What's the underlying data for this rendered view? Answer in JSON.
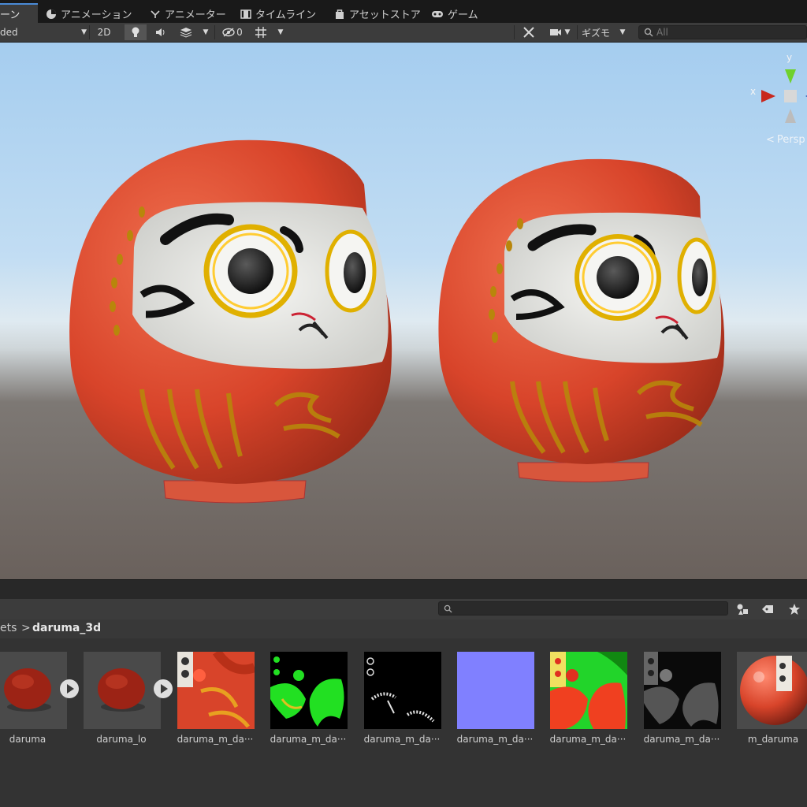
{
  "tabs": [
    {
      "label": "ーン",
      "icon": "scene-icon"
    },
    {
      "label": "アニメーション",
      "icon": "animation-icon"
    },
    {
      "label": "アニメーター",
      "icon": "animator-icon"
    },
    {
      "label": "タイムライン",
      "icon": "timeline-icon"
    },
    {
      "label": "アセットストア",
      "icon": "asset-store-icon"
    },
    {
      "label": "ゲーム",
      "icon": "game-icon"
    }
  ],
  "toolbar": {
    "shading_mode": "ded",
    "mode_2d": "2D",
    "hidden_count": "0",
    "gizmos_label": "ギズモ",
    "search_placeholder": "All"
  },
  "gizmo": {
    "y_label": "y",
    "x_label": "x",
    "projection": "Persp"
  },
  "breadcrumb": {
    "parent": "ets",
    "separator": ">",
    "current": "daruma_3d"
  },
  "assets": [
    {
      "label": "daruma",
      "kind": "model"
    },
    {
      "label": "daruma_lo",
      "kind": "model"
    },
    {
      "label": "daruma_m_da···",
      "kind": "albedo"
    },
    {
      "label": "daruma_m_da···",
      "kind": "mask-green"
    },
    {
      "label": "daruma_m_da···",
      "kind": "mask-black"
    },
    {
      "label": "daruma_m_da···",
      "kind": "normal"
    },
    {
      "label": "daruma_m_da···",
      "kind": "mask-red"
    },
    {
      "label": "daruma_m_da···",
      "kind": "roughness"
    },
    {
      "label": "m_daruma",
      "kind": "material"
    }
  ],
  "colors": {
    "accent": "#4a8bd6",
    "daruma_red": "#d8442a",
    "gold": "#b8860b"
  }
}
